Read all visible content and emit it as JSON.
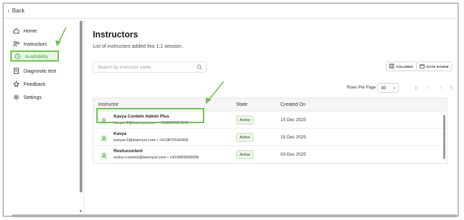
{
  "topbar": {
    "back_label": "Back"
  },
  "sidebar": {
    "items": [
      {
        "label": "Home",
        "icon": "home-icon"
      },
      {
        "label": "Instructors",
        "icon": "instructors-icon"
      },
      {
        "label": "Availability",
        "icon": "clock-icon",
        "active": true
      },
      {
        "label": "Diagnostic test",
        "icon": "document-icon"
      },
      {
        "label": "Feedback",
        "icon": "star-icon"
      },
      {
        "label": "Settings",
        "icon": "gear-icon"
      }
    ]
  },
  "main": {
    "title": "Instructors",
    "subtitle": "List of instructors added this 1:1 session.",
    "search_placeholder": "Search by instructor name",
    "columns_button": "COLUMNS",
    "date_range_button": "DATE RANGE",
    "rows_per_page_label": "Rows Per Page",
    "rows_per_page_value": "30",
    "table": {
      "headers": [
        "Instructor",
        "State",
        "Created On"
      ],
      "rows": [
        {
          "name": "Kavya Contetn Admin Plus",
          "contact": "kavya+3@learnyst.com  •  +910987654345",
          "state": "Active",
          "created_on": "15 Dec 2025"
        },
        {
          "name": "Kavya",
          "contact": "kavya+2@learnyst.com  •  +919876543456",
          "state": "Active",
          "created_on": "15 Dec 2025"
        },
        {
          "name": "Reshucontent",
          "contact": "reshu+content@learnyst.com  •  +919999999999",
          "state": "Active",
          "created_on": "03 Dec 2025"
        }
      ]
    }
  },
  "colors": {
    "accent_green": "#6cc24a",
    "active_bg": "#e9f8e6"
  }
}
